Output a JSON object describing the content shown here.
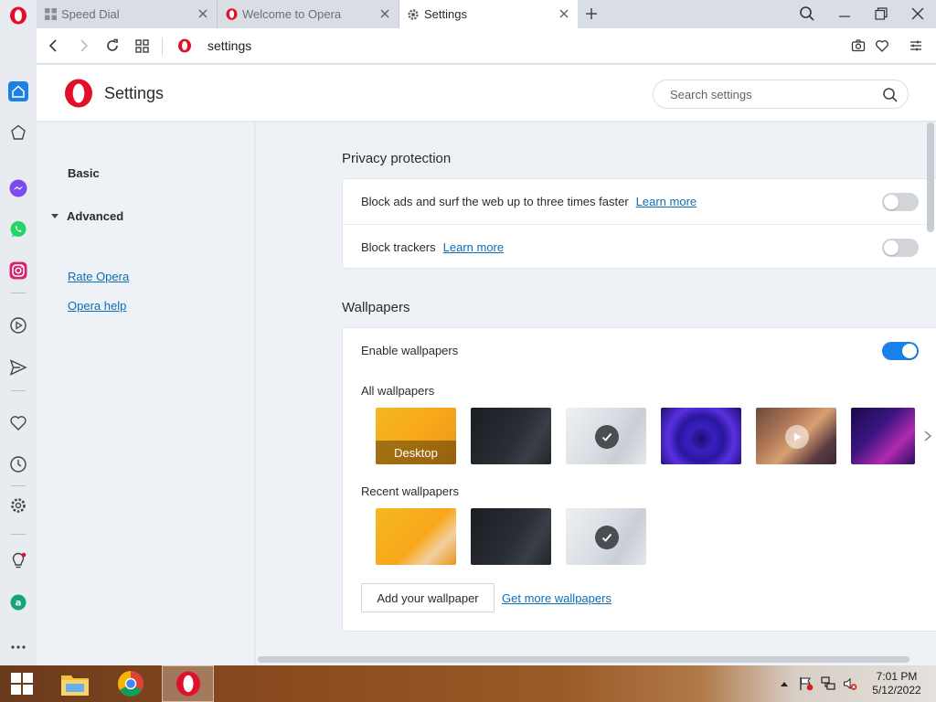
{
  "tabs": [
    {
      "label": "Speed Dial",
      "icon": "grid-icon"
    },
    {
      "label": "Welcome to Opera",
      "icon": "opera-icon"
    },
    {
      "label": "Settings",
      "icon": "gear-icon"
    }
  ],
  "address": {
    "url": "settings"
  },
  "header": {
    "title": "Settings",
    "search_placeholder": "Search settings"
  },
  "leftnav": {
    "basic": "Basic",
    "advanced": "Advanced",
    "rate": "Rate Opera",
    "help": "Opera help"
  },
  "privacy": {
    "title": "Privacy protection",
    "rows": [
      {
        "text": "Block ads and surf the web up to three times faster",
        "link": "Learn more",
        "enabled": false
      },
      {
        "text": "Block trackers",
        "link": "Learn more",
        "enabled": false
      }
    ]
  },
  "wallpapers": {
    "title": "Wallpapers",
    "enable_label": "Enable wallpapers",
    "enabled": true,
    "all_label": "All wallpapers",
    "recent_label": "Recent wallpapers",
    "desktop_caption": "Desktop",
    "add_button": "Add your wallpaper",
    "more_link": "Get more wallpapers"
  },
  "taskbar": {
    "time": "7:01 PM",
    "date": "5/12/2022"
  },
  "colors": {
    "accent": "#1a81e8",
    "opera_red": "#e0102a",
    "link": "#0b6fb8"
  }
}
